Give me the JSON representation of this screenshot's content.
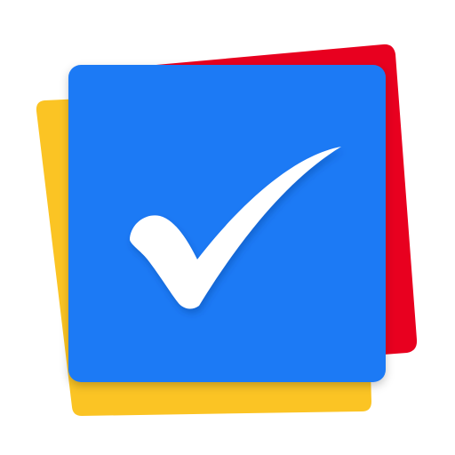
{
  "app_icon": {
    "name": "checkmark-app-logo",
    "colors": {
      "background": "#ffffff",
      "back_card_yellow": "#FBC424",
      "back_card_red": "#E8001F",
      "front_card_blue": "#1F7AF5",
      "checkmark": "#ffffff"
    },
    "icons": [
      "yellow-card",
      "red-card",
      "blue-card",
      "checkmark-icon"
    ]
  }
}
